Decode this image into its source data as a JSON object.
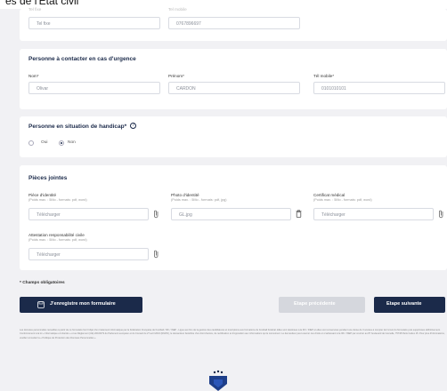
{
  "header": {
    "title": "es de l'État civil"
  },
  "contact": {
    "tel_fixe": {
      "label": "Tel fixe",
      "value": "Tel fixe"
    },
    "tel_mobile": {
      "label": "Tel mobile",
      "value": "0767896697"
    }
  },
  "emergency": {
    "title": "Personne à contacter en cas d'urgence",
    "nom": {
      "label": "Nom*",
      "value": "Olivar"
    },
    "prenom": {
      "label": "Prénom*",
      "value": "CARDON"
    },
    "tel": {
      "label": "Tél mobile*",
      "value": "0101010101"
    }
  },
  "handicap": {
    "title": "Personne en situation de handicap*",
    "help_icon": "help-circle-icon",
    "options": [
      {
        "label": "Oui",
        "selected": false
      },
      {
        "label": "Non",
        "selected": true
      }
    ]
  },
  "attachments": {
    "title": "Pièces jointes",
    "identite": {
      "label": "Pièce d'identité",
      "note": "(Poids max. : 5Mo - formats: pdf, word)",
      "value": "Télécharger"
    },
    "photo": {
      "label": "Photo d'identité",
      "note": "(Poids max. : 5Mo - formats: pdf, jpg)",
      "value": "GL.jpg"
    },
    "medical": {
      "label": "Certificat médical",
      "note": "(Poids max. : 5Mo - formats: pdf, word)",
      "value": "Télécharger"
    },
    "assurance": {
      "label": "Attestation responsabilité civile",
      "note": "(Poids max. : 5Mo - formats: pdf, word)",
      "value": "Télécharger"
    }
  },
  "required_note": "* Champs obligatoires",
  "buttons": {
    "save": "J'enregistre mon formulaire",
    "prev": "Etape précédente",
    "next": "Etape suivante"
  },
  "legal_text": "Les données personnelles recueillies à partir de ce formulaire font l'objet d'un traitement informatique par la Fédération Française de Football / IFF / INEP - Ligue aux fins de la gestion des candidatures et inscriptions aux formations du Football Fédéral. Elles sont destinées à la IFF / INEP et elles sont conservées pendant une durée de 3 années à compter de l'envoi du formulaire puis supprimées définitivement. Conformément à la loi « Informatique et Libertés » et au Règlement (UE) 2016/679 du Parlement européen et du Conseil du 27 avril 2016 (RGPD), le demandeur bénéficie d'un droit d'accès, de rectification et d'opposition aux informations qui le concernent. Le demandeur peut exercer ces droits en s'adressant à la IFF / INEP par courrier au 87 boulevard de Grenelle, 75738 Paris Cedex 15. Pour plus d'informations, veuillez consulter la « Politique de Protection des Données Personnelles ».",
  "colors": {
    "navy": "#1b2a4a",
    "disabled": "#d5d7dd",
    "background": "#f1f1f4"
  }
}
